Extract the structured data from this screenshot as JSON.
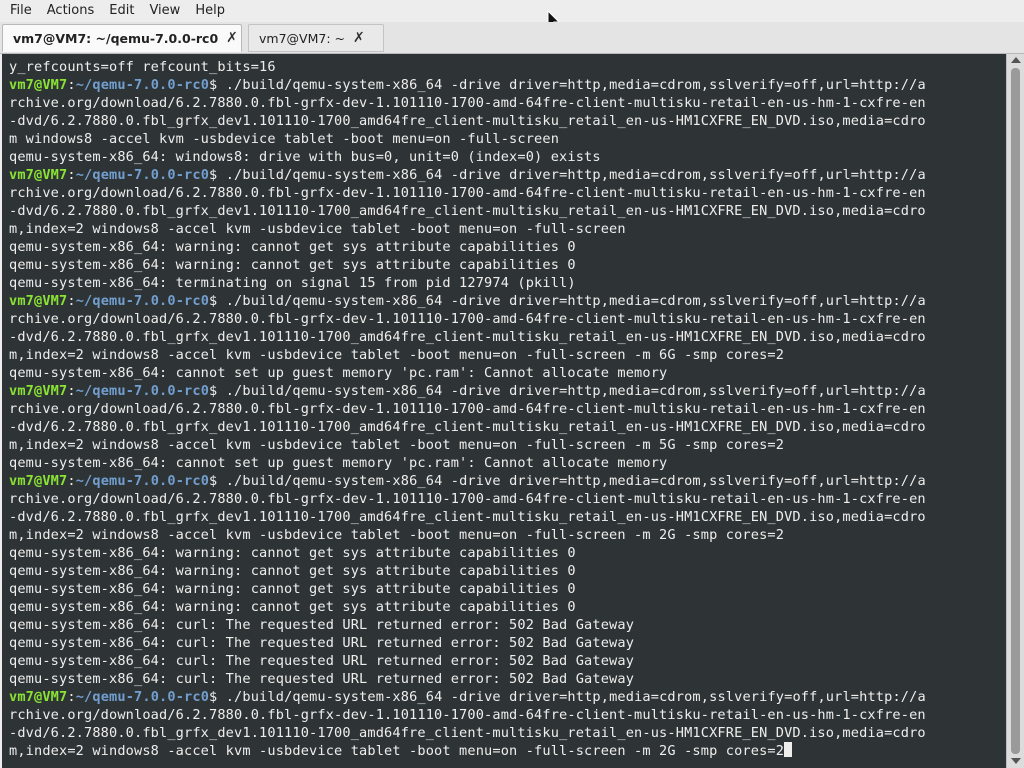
{
  "menu": [
    "File",
    "Actions",
    "Edit",
    "View",
    "Help"
  ],
  "tabs": [
    {
      "label": "vm7@VM7: ~/qemu-7.0.0-rc0",
      "close": "✗"
    },
    {
      "label": "vm7@VM7: ~",
      "close": "✗"
    }
  ],
  "colors": {
    "terminal_bg": "#2e3436",
    "prompt_user": "#8ae234",
    "prompt_dir": "#729fcf",
    "text": "#eeeeec"
  },
  "terminal": {
    "prompt": {
      "user": "vm7@VM7",
      "colon": ":",
      "dir": "~/qemu-7.0.0-rc0",
      "symbol": "$"
    },
    "lines": [
      "y_refcounts=off refcount_bits=16",
      " ./build/qemu-system-x86_64 -drive driver=http,media=cdrom,sslverify=off,url=http://a",
      "rchive.org/download/6.2.7880.0.fbl-grfx-dev-1.101110-1700-amd-64fre-client-multisku-retail-en-us-hm-1-cxfre-en",
      "-dvd/6.2.7880.0.fbl_grfx_dev1.101110-1700_amd64fre_client-multisku_retail_en-us-HM1CXFRE_EN_DVD.iso,media=cdro",
      "m windows8 -accel kvm -usbdevice tablet -boot menu=on -full-screen",
      "qemu-system-x86_64: windows8: drive with bus=0, unit=0 (index=0) exists",
      " ./build/qemu-system-x86_64 -drive driver=http,media=cdrom,sslverify=off,url=http://a",
      "rchive.org/download/6.2.7880.0.fbl-grfx-dev-1.101110-1700-amd-64fre-client-multisku-retail-en-us-hm-1-cxfre-en",
      "-dvd/6.2.7880.0.fbl_grfx_dev1.101110-1700_amd64fre_client-multisku_retail_en-us-HM1CXFRE_EN_DVD.iso,media=cdro",
      "m,index=2 windows8 -accel kvm -usbdevice tablet -boot menu=on -full-screen",
      "qemu-system-x86_64: warning: cannot get sys attribute capabilities 0",
      "qemu-system-x86_64: warning: cannot get sys attribute capabilities 0",
      "qemu-system-x86_64: terminating on signal 15 from pid 127974 (pkill)",
      " ./build/qemu-system-x86_64 -drive driver=http,media=cdrom,sslverify=off,url=http://a",
      "rchive.org/download/6.2.7880.0.fbl-grfx-dev-1.101110-1700-amd-64fre-client-multisku-retail-en-us-hm-1-cxfre-en",
      "-dvd/6.2.7880.0.fbl_grfx_dev1.101110-1700_amd64fre_client-multisku_retail_en-us-HM1CXFRE_EN_DVD.iso,media=cdro",
      "m,index=2 windows8 -accel kvm -usbdevice tablet -boot menu=on -full-screen -m 6G -smp cores=2",
      "qemu-system-x86_64: cannot set up guest memory 'pc.ram': Cannot allocate memory",
      " ./build/qemu-system-x86_64 -drive driver=http,media=cdrom,sslverify=off,url=http://a",
      "rchive.org/download/6.2.7880.0.fbl-grfx-dev-1.101110-1700-amd-64fre-client-multisku-retail-en-us-hm-1-cxfre-en",
      "-dvd/6.2.7880.0.fbl_grfx_dev1.101110-1700_amd64fre_client-multisku_retail_en-us-HM1CXFRE_EN_DVD.iso,media=cdro",
      "m,index=2 windows8 -accel kvm -usbdevice tablet -boot menu=on -full-screen -m 5G -smp cores=2",
      "qemu-system-x86_64: cannot set up guest memory 'pc.ram': Cannot allocate memory",
      " ./build/qemu-system-x86_64 -drive driver=http,media=cdrom,sslverify=off,url=http://a",
      "rchive.org/download/6.2.7880.0.fbl-grfx-dev-1.101110-1700-amd-64fre-client-multisku-retail-en-us-hm-1-cxfre-en",
      "-dvd/6.2.7880.0.fbl_grfx_dev1.101110-1700_amd64fre_client-multisku_retail_en-us-HM1CXFRE_EN_DVD.iso,media=cdro",
      "m,index=2 windows8 -accel kvm -usbdevice tablet -boot menu=on -full-screen -m 2G -smp cores=2",
      "qemu-system-x86_64: warning: cannot get sys attribute capabilities 0",
      "qemu-system-x86_64: warning: cannot get sys attribute capabilities 0",
      "qemu-system-x86_64: warning: cannot get sys attribute capabilities 0",
      "qemu-system-x86_64: warning: cannot get sys attribute capabilities 0",
      "qemu-system-x86_64: curl: The requested URL returned error: 502 Bad Gateway",
      "qemu-system-x86_64: curl: The requested URL returned error: 502 Bad Gateway",
      "qemu-system-x86_64: curl: The requested URL returned error: 502 Bad Gateway",
      "qemu-system-x86_64: curl: The requested URL returned error: 502 Bad Gateway",
      " ./build/qemu-system-x86_64 -drive driver=http,media=cdrom,sslverify=off,url=http://a",
      "rchive.org/download/6.2.7880.0.fbl-grfx-dev-1.101110-1700-amd-64fre-client-multisku-retail-en-us-hm-1-cxfre-en",
      "-dvd/6.2.7880.0.fbl_grfx_dev1.101110-1700_amd64fre_client-multisku_retail_en-us-HM1CXFRE_EN_DVD.iso,media=cdro",
      "m,index=2 windows8 -accel kvm -usbdevice tablet -boot menu=on -full-screen -m 2G -smp cores=2"
    ]
  }
}
